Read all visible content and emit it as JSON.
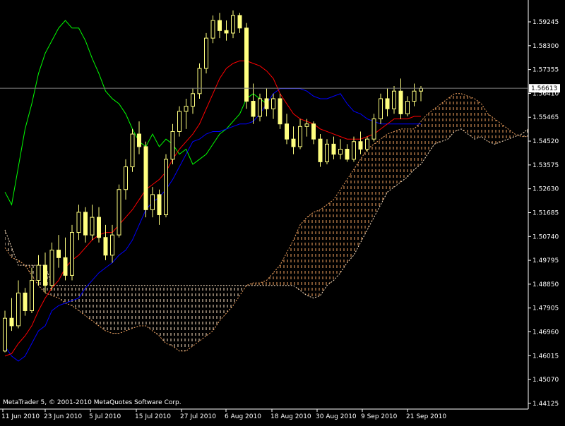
{
  "chart_data": {
    "type": "candlestick",
    "symbol": "",
    "copyright": "MetaTrader 5, © 2001-2010 MetaQuotes Software Corp.",
    "current_price": "1.56613",
    "colors": {
      "background": "#000000",
      "axis": "#ffffff",
      "candle": "#ffff80",
      "tenkan": "#ff0000",
      "kijun": "#0000ff",
      "chikou": "#00ff00",
      "senkou_a": "#f4a460",
      "senkou_b": "#ffe4c4",
      "price_line": "#808080"
    },
    "y_ticks": [
      "1.59245",
      "1.58300",
      "1.57355",
      "1.56410",
      "1.55465",
      "1.54520",
      "1.53575",
      "1.52630",
      "1.51685",
      "1.50740",
      "1.49795",
      "1.48850",
      "1.47905",
      "1.46960",
      "1.46015",
      "1.45070",
      "1.44125"
    ],
    "x_ticks": [
      "11 Jun 2010",
      "23 Jun 2010",
      "5 Jul 2010",
      "15 Jul 2010",
      "27 Jul 2010",
      "6 Aug 2010",
      "18 Aug 2010",
      "30 Aug 2010",
      "9 Sep 2010",
      "21 Sep 2010"
    ],
    "ylim": [
      1.439,
      1.6
    ],
    "candles": [
      [
        1.462,
        1.478,
        1.4615,
        1.475
      ],
      [
        1.475,
        1.483,
        1.47,
        1.472
      ],
      [
        1.472,
        1.49,
        1.471,
        1.485
      ],
      [
        1.485,
        1.487,
        1.476,
        1.478
      ],
      [
        1.478,
        1.495,
        1.477,
        1.49
      ],
      [
        1.49,
        1.5,
        1.488,
        1.496
      ],
      [
        1.496,
        1.501,
        1.485,
        1.488
      ],
      [
        1.488,
        1.505,
        1.486,
        1.502
      ],
      [
        1.502,
        1.508,
        1.495,
        1.499
      ],
      [
        1.499,
        1.507,
        1.49,
        1.492
      ],
      [
        1.492,
        1.512,
        1.49,
        1.509
      ],
      [
        1.509,
        1.52,
        1.506,
        1.517
      ],
      [
        1.517,
        1.519,
        1.505,
        1.508
      ],
      [
        1.508,
        1.52,
        1.506,
        1.515
      ],
      [
        1.515,
        1.519,
        1.505,
        1.507
      ],
      [
        1.507,
        1.512,
        1.498,
        1.5
      ],
      [
        1.5,
        1.512,
        1.497,
        1.508
      ],
      [
        1.508,
        1.528,
        1.507,
        1.526
      ],
      [
        1.526,
        1.538,
        1.522,
        1.535
      ],
      [
        1.535,
        1.55,
        1.533,
        1.548
      ],
      [
        1.548,
        1.553,
        1.54,
        1.543
      ],
      [
        1.543,
        1.545,
        1.515,
        1.518
      ],
      [
        1.518,
        1.527,
        1.515,
        1.524
      ],
      [
        1.524,
        1.526,
        1.512,
        1.516
      ],
      [
        1.516,
        1.54,
        1.515,
        1.538
      ],
      [
        1.538,
        1.552,
        1.536,
        1.549
      ],
      [
        1.549,
        1.559,
        1.547,
        1.557
      ],
      [
        1.557,
        1.562,
        1.55,
        1.559
      ],
      [
        1.559,
        1.566,
        1.556,
        1.564
      ],
      [
        1.564,
        1.576,
        1.562,
        1.574
      ],
      [
        1.574,
        1.588,
        1.572,
        1.586
      ],
      [
        1.586,
        1.595,
        1.584,
        1.593
      ],
      [
        1.593,
        1.596,
        1.586,
        1.589
      ],
      [
        1.589,
        1.593,
        1.585,
        1.588
      ],
      [
        1.588,
        1.597,
        1.586,
        1.595
      ],
      [
        1.595,
        1.596,
        1.588,
        1.59
      ],
      [
        1.59,
        1.592,
        1.558,
        1.561
      ],
      [
        1.561,
        1.568,
        1.552,
        1.555
      ],
      [
        1.555,
        1.564,
        1.553,
        1.562
      ],
      [
        1.562,
        1.566,
        1.555,
        1.558
      ],
      [
        1.558,
        1.564,
        1.554,
        1.562
      ],
      [
        1.562,
        1.564,
        1.55,
        1.552
      ],
      [
        1.552,
        1.556,
        1.544,
        1.546
      ],
      [
        1.546,
        1.551,
        1.54,
        1.543
      ],
      [
        1.543,
        1.554,
        1.542,
        1.551
      ],
      [
        1.551,
        1.554,
        1.547,
        1.552
      ],
      [
        1.552,
        1.553,
        1.544,
        1.546
      ],
      [
        1.546,
        1.548,
        1.535,
        1.537
      ],
      [
        1.537,
        1.546,
        1.536,
        1.544
      ],
      [
        1.544,
        1.547,
        1.538,
        1.54
      ],
      [
        1.54,
        1.546,
        1.538,
        1.542
      ],
      [
        1.542,
        1.544,
        1.537,
        1.538
      ],
      [
        1.538,
        1.547,
        1.537,
        1.545
      ],
      [
        1.545,
        1.549,
        1.54,
        1.542
      ],
      [
        1.542,
        1.547,
        1.541,
        1.546
      ],
      [
        1.546,
        1.556,
        1.545,
        1.554
      ],
      [
        1.554,
        1.564,
        1.552,
        1.562
      ],
      [
        1.562,
        1.566,
        1.555,
        1.558
      ],
      [
        1.558,
        1.567,
        1.556,
        1.565
      ],
      [
        1.565,
        1.57,
        1.554,
        1.556
      ],
      [
        1.556,
        1.563,
        1.555,
        1.561
      ],
      [
        1.561,
        1.568,
        1.559,
        1.565
      ],
      [
        1.565,
        1.567,
        1.561,
        1.5661
      ]
    ],
    "tenkan": [
      1.46,
      1.461,
      1.465,
      1.468,
      1.472,
      1.478,
      1.483,
      1.487,
      1.49,
      1.495,
      1.498,
      1.5,
      1.503,
      1.506,
      1.508,
      1.509,
      1.509,
      1.512,
      1.515,
      1.518,
      1.522,
      1.526,
      1.528,
      1.53,
      1.533,
      1.538,
      1.542,
      1.545,
      1.548,
      1.552,
      1.558,
      1.564,
      1.57,
      1.574,
      1.576,
      1.577,
      1.577,
      1.576,
      1.575,
      1.573,
      1.57,
      1.564,
      1.56,
      1.556,
      1.554,
      1.553,
      1.552,
      1.55,
      1.549,
      1.548,
      1.547,
      1.546,
      1.546,
      1.546,
      1.547,
      1.548,
      1.55,
      1.552,
      1.554,
      1.554,
      1.554,
      1.555,
      1.555
    ],
    "kijun": [
      1.464,
      1.46,
      1.458,
      1.46,
      1.465,
      1.47,
      1.472,
      1.478,
      1.48,
      1.481,
      1.482,
      1.483,
      1.487,
      1.49,
      1.493,
      1.495,
      1.497,
      1.5,
      1.502,
      1.506,
      1.512,
      1.518,
      1.521,
      1.523,
      1.526,
      1.53,
      1.535,
      1.54,
      1.545,
      1.546,
      1.548,
      1.549,
      1.549,
      1.55,
      1.551,
      1.552,
      1.552,
      1.553,
      1.556,
      1.56,
      1.564,
      1.566,
      1.566,
      1.566,
      1.566,
      1.565,
      1.563,
      1.562,
      1.562,
      1.563,
      1.564,
      1.56,
      1.557,
      1.556,
      1.554,
      1.553,
      1.552,
      1.552,
      1.552,
      1.552,
      1.552,
      1.552,
      1.552
    ],
    "chikou": [
      1.525,
      1.52,
      1.535,
      1.55,
      1.56,
      1.572,
      1.58,
      1.585,
      1.59,
      1.593,
      1.59,
      1.59,
      1.585,
      1.578,
      1.572,
      1.565,
      1.562,
      1.56,
      1.556,
      1.55,
      1.545,
      1.543,
      1.548,
      1.543,
      1.546,
      1.544,
      1.54,
      1.542,
      1.536,
      1.538,
      1.54,
      1.544,
      1.548,
      1.55,
      1.553,
      1.556,
      1.562,
      1.564,
      1.562,
      1.56
    ],
    "senkou_a": [
      1.503,
      1.499,
      1.498,
      1.496,
      1.492,
      1.488,
      1.485,
      1.484,
      1.483,
      1.481,
      1.48,
      1.478,
      1.476,
      1.474,
      1.472,
      1.47,
      1.469,
      1.469,
      1.47,
      1.471,
      1.472,
      1.472,
      1.47,
      1.468,
      1.465,
      1.464,
      1.462,
      1.462,
      1.464,
      1.466,
      1.468,
      1.47,
      1.474,
      1.477,
      1.48,
      1.484,
      1.488,
      1.489,
      1.489,
      1.49,
      1.493,
      1.496,
      1.501,
      1.506,
      1.512,
      1.515,
      1.517,
      1.518,
      1.52,
      1.522,
      1.526,
      1.53,
      1.534,
      1.538,
      1.542,
      1.544,
      1.546,
      1.548,
      1.549,
      1.55,
      1.55,
      1.55,
      1.553,
      1.556,
      1.558,
      1.56,
      1.562,
      1.564,
      1.564,
      1.563,
      1.562,
      1.56,
      1.556,
      1.554,
      1.552,
      1.55,
      1.548,
      1.547,
      1.547
    ],
    "senkou_b": [
      1.51,
      1.503,
      1.496,
      1.496,
      1.496,
      1.496,
      1.496,
      1.488,
      1.488,
      1.488,
      1.488,
      1.488,
      1.488,
      1.488,
      1.488,
      1.488,
      1.488,
      1.488,
      1.488,
      1.488,
      1.488,
      1.488,
      1.488,
      1.488,
      1.488,
      1.488,
      1.488,
      1.488,
      1.488,
      1.488,
      1.488,
      1.488,
      1.488,
      1.488,
      1.488,
      1.488,
      1.488,
      1.488,
      1.488,
      1.488,
      1.488,
      1.488,
      1.488,
      1.488,
      1.486,
      1.484,
      1.483,
      1.484,
      1.488,
      1.49,
      1.493,
      1.497,
      1.5,
      1.505,
      1.51,
      1.515,
      1.52,
      1.525,
      1.527,
      1.529,
      1.531,
      1.534,
      1.536,
      1.54,
      1.544,
      1.545,
      1.546,
      1.549,
      1.55,
      1.548,
      1.546,
      1.547,
      1.545,
      1.544,
      1.545,
      1.546,
      1.547,
      1.548,
      1.55
    ]
  }
}
